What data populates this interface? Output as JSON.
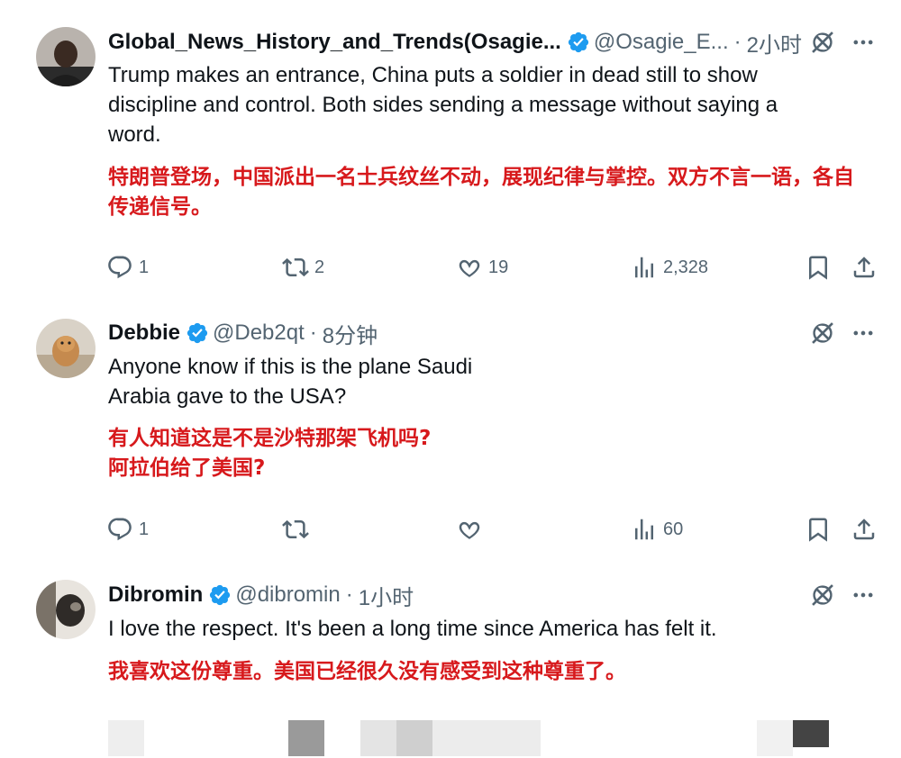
{
  "tweets": [
    {
      "name": "Global_News_History_and_Trends(Osagie...",
      "handle": "@Osagie_E...",
      "dot": "·",
      "time": "2小时",
      "text_en": "Trump makes an entrance, China puts a soldier in dead still to show discipline and control. Both sides sending a message without saying a word.",
      "text_zh": "特朗普登场，中国派出一名士兵纹丝不动，展现纪律与掌控。双方不言一语，各自传递信号。",
      "replies": "1",
      "retweets": "2",
      "likes": "19",
      "views": "2,328"
    },
    {
      "name": "Debbie",
      "handle": "@Deb2qt",
      "dot": "·",
      "time": "8分钟",
      "text_en_line1": "Anyone know if this is the plane Saudi",
      "text_en_line2": "Arabia gave to the USA?",
      "text_zh_line1": "有人知道这是不是沙特那架飞机吗?",
      "text_zh_line2": "阿拉伯给了美国?",
      "replies": "1",
      "retweets": "",
      "likes": "",
      "views": "60"
    },
    {
      "name": "Dibromin",
      "handle": "@dibromin",
      "dot": "·",
      "time": "1小时",
      "text_en": "I love the respect.  It's been a long time since America has felt it.",
      "text_zh": "我喜欢这份尊重。美国已经很久没有感受到这种尊重了。"
    }
  ],
  "colors": {
    "verified": "#1d9bf0",
    "translation": "#d7191c",
    "secondary_text": "#536471"
  },
  "icons": [
    "reply-icon",
    "retweet-icon",
    "like-icon",
    "views-icon",
    "bookmark-icon",
    "share-icon",
    "grok-icon",
    "more-icon",
    "verified-badge-icon"
  ]
}
